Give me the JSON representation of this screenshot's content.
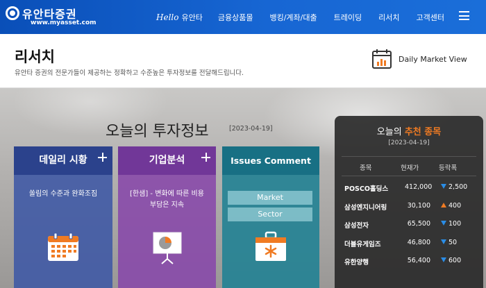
{
  "header": {
    "logo_text": "유안타증권",
    "logo_url": "www.myasset.com",
    "nav": [
      {
        "prefix": "Hello",
        "label": "유안타"
      },
      {
        "label": "금융상품몰"
      },
      {
        "label": "뱅킹/계좌/대출"
      },
      {
        "label": "트레이딩"
      },
      {
        "label": "리서치"
      },
      {
        "label": "고객센터"
      }
    ]
  },
  "page": {
    "title": "리서치",
    "subtitle": "유안타 증권의 전문가들이 제공하는 정확하고 수준높은 투자정보를 전달해드립니다.",
    "daily_market_view": "Daily Market View"
  },
  "hero": {
    "title": "오늘의 투자정보",
    "date": "[2023-04-19]"
  },
  "cards": {
    "daily": {
      "title": "데일리 시황",
      "text": "쏠림의 수준과 완화조짐",
      "icon": "calendar-icon"
    },
    "corp": {
      "title": "기업분석",
      "text_1": "[한샘] - 변화에 따른 비용",
      "text_2": "부담은 지속",
      "icon": "presentation-chart-icon"
    },
    "issues": {
      "title": "Issues Comment",
      "buttons": [
        "Market",
        "Sector"
      ],
      "icon": "briefcase-icon"
    }
  },
  "recommended": {
    "title_prefix": "오늘의",
    "title_accent": "추천 종목",
    "date": "[2023-04-19]",
    "columns": [
      "종목",
      "현재가",
      "등락폭"
    ],
    "rows": [
      {
        "name": "POSCO홀딩스",
        "price": "412,000",
        "change": "2,500",
        "dir": "down"
      },
      {
        "name": "삼성엔지니어링",
        "price": "30,100",
        "change": "400",
        "dir": "up"
      },
      {
        "name": "삼성전자",
        "price": "65,500",
        "change": "100",
        "dir": "down"
      },
      {
        "name": "더블유게임즈",
        "price": "46,800",
        "change": "50",
        "dir": "down"
      },
      {
        "name": "유한양행",
        "price": "56,400",
        "change": "600",
        "dir": "down"
      }
    ]
  },
  "colors": {
    "brand_blue": "#0a4fb8",
    "accent_orange": "#f07b23",
    "down_blue": "#2a8de6"
  }
}
